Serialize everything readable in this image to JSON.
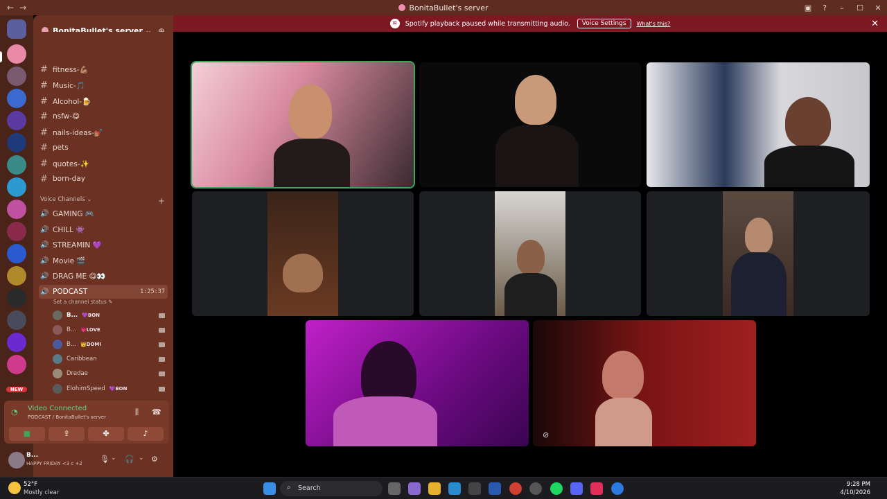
{
  "window": {
    "title": "BonitaBullet's server"
  },
  "banner": {
    "message": "Spotify playback paused while transmitting audio.",
    "button_label": "Voice Settings",
    "link_label": "What's this?"
  },
  "server": {
    "name": "BonitaBullet's server"
  },
  "text_channels": [
    "fitness-💪🏽",
    "Music-🎵",
    "Alcohol-🍺",
    "nsfw-😋",
    "nails-ideas-💅🏽",
    "pets",
    "quotes-✨",
    "born-day"
  ],
  "voice_category": "Voice Channels",
  "voice_channels": [
    "GAMING 🎮",
    "CHILL 👾",
    "STREAMIN 💜",
    "Movie 🎬",
    "DRAG ME 😋👀"
  ],
  "active_voice": {
    "name": "PODCAST",
    "time": "1:25:37",
    "status": "Set a channel status"
  },
  "members": [
    {
      "name": "B...",
      "tag": "💜BON"
    },
    {
      "name": "B...",
      "tag": "💗LOVE"
    },
    {
      "name": "B...",
      "tag": "👑DOMI"
    },
    {
      "name": "Caribbean",
      "tag": ""
    },
    {
      "name": "Dredae",
      "tag": ""
    },
    {
      "name": "ElohimSpeed",
      "tag": "💜BON"
    }
  ],
  "voice_connection": {
    "title": "Video Connected",
    "subtitle": "PODCAST / BonitaBullet's server"
  },
  "user": {
    "name": "B...",
    "status": "HAPPY FRIDAY <3 c +2"
  },
  "rail_new_label": "NEW",
  "taskbar": {
    "temp": "52°F",
    "condition": "Mostly clear",
    "search_label": "Search",
    "time": "9:28 PM",
    "date": "4/10/2026"
  },
  "colors": {
    "speaking": "#3ba55c",
    "connected": "#5fd38a",
    "banner": "#7b1822"
  }
}
